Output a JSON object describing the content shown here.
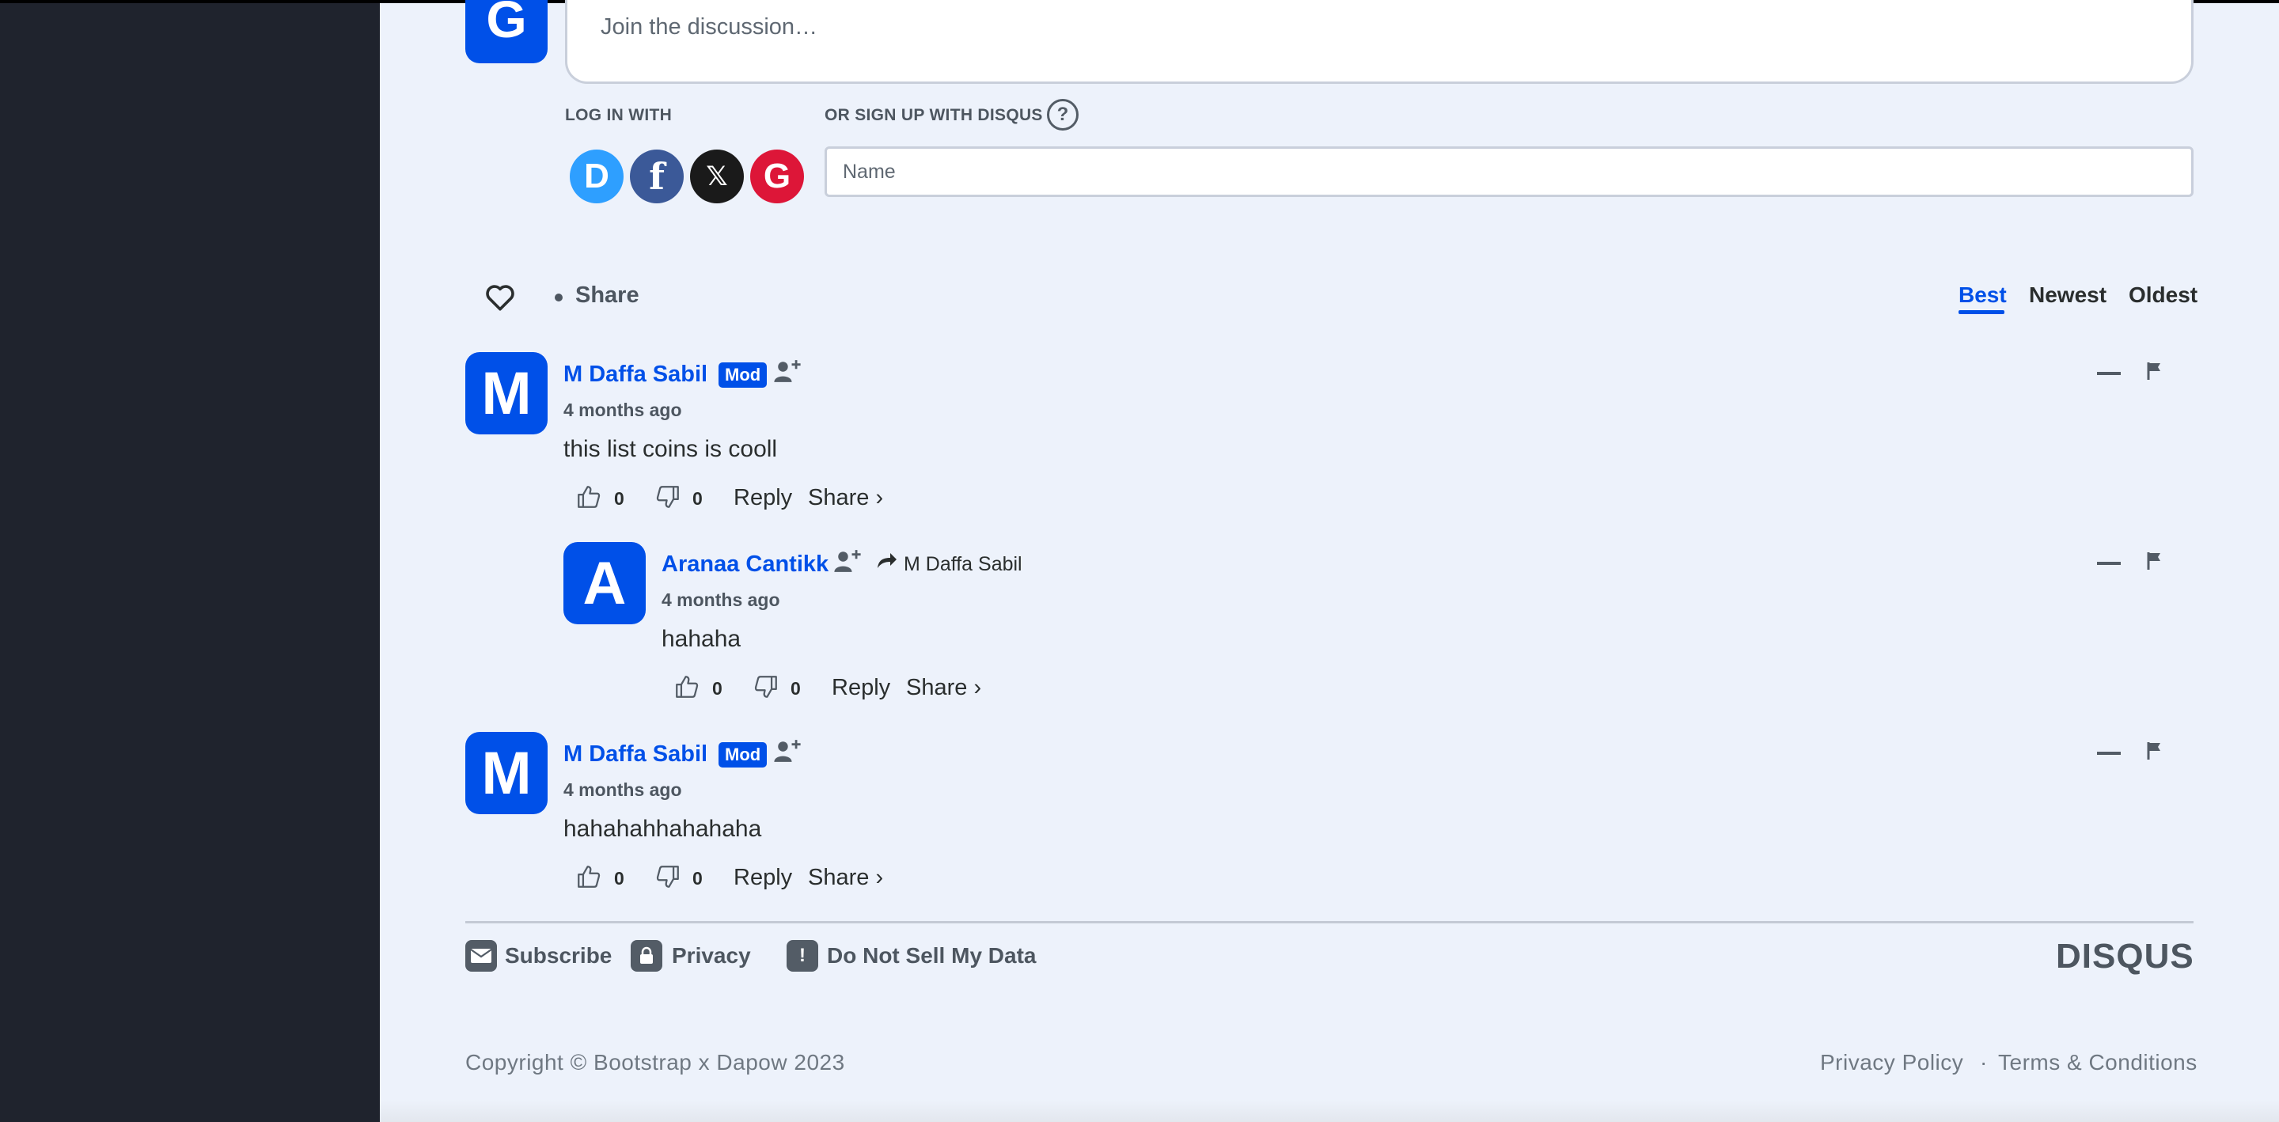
{
  "composer": {
    "avatar_letter": "G",
    "placeholder": "Join the discussion…",
    "login_with_label": "LOG IN WITH",
    "signup_label": "OR SIGN UP WITH DISQUS",
    "help_symbol": "?",
    "name_placeholder": "Name",
    "social": [
      {
        "name": "disqus-login-icon",
        "letter": "D",
        "color": "#2e9fff"
      },
      {
        "name": "facebook-login-icon",
        "letter": "f",
        "color": "#3b5998"
      },
      {
        "name": "x-login-icon",
        "letter": "𝕏",
        "color": "#1a1a1a"
      },
      {
        "name": "google-login-icon",
        "letter": "G",
        "color": "#dd1638"
      }
    ]
  },
  "toolbar": {
    "share_label": "Share",
    "sort_options": [
      "Best",
      "Newest",
      "Oldest"
    ],
    "active_sort": "Best"
  },
  "comments": [
    {
      "avatar_letter": "M",
      "author": "M Daffa Sabil",
      "badge": "Mod",
      "time": "4 months ago",
      "text": "this list coins is cooll",
      "upvotes": "0",
      "downvotes": "0",
      "reply_label": "Reply",
      "share_label": "Share ›"
    },
    {
      "avatar_letter": "A",
      "author": "Aranaa Cantikk",
      "reply_to": "M Daffa Sabil",
      "time": "4 months ago",
      "text": "hahaha",
      "upvotes": "0",
      "downvotes": "0",
      "reply_label": "Reply",
      "share_label": "Share ›"
    },
    {
      "avatar_letter": "M",
      "author": "M Daffa Sabil",
      "badge": "Mod",
      "time": "4 months ago",
      "text": "hahahahhahahaha",
      "upvotes": "0",
      "downvotes": "0",
      "reply_label": "Reply",
      "share_label": "Share ›"
    }
  ],
  "footer": {
    "subscribe": "Subscribe",
    "privacy": "Privacy",
    "do_not_sell": "Do Not Sell My Data",
    "do_not_sell_symbol": "!",
    "logo": "DISQUS"
  },
  "page_footer": {
    "copyright": "Copyright © Bootstrap x Dapow 2023",
    "privacy_policy": "Privacy Policy",
    "separator": "·",
    "terms": "Terms & Conditions"
  },
  "colors": {
    "accent": "#0050e8",
    "sidebar": "#1f232d",
    "background": "#edf2fb"
  }
}
